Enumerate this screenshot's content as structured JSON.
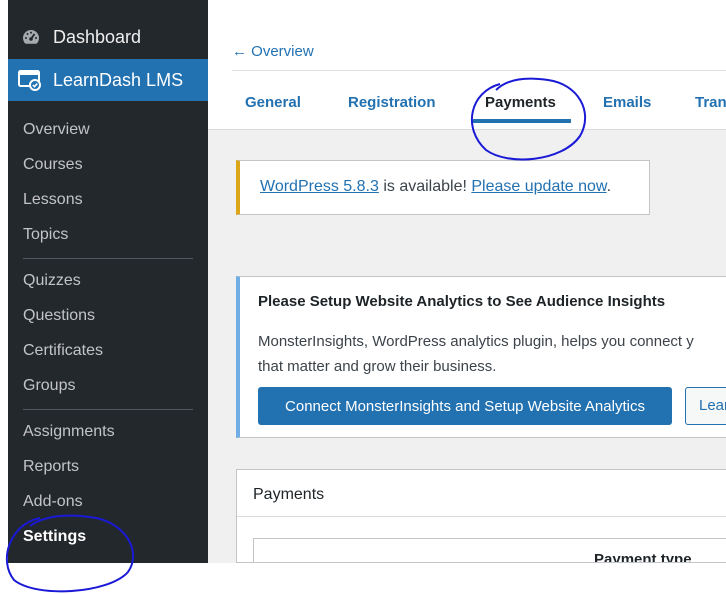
{
  "sidebar": {
    "dashboard_label": "Dashboard",
    "dashboard_icon": "dashboard-gauge-icon",
    "learndash_label": "LearnDash LMS",
    "learndash_icon": "learndash-certificate-icon",
    "items": [
      {
        "label": "Overview"
      },
      {
        "label": "Courses"
      },
      {
        "label": "Lessons"
      },
      {
        "label": "Topics"
      },
      {
        "label": "Quizzes"
      },
      {
        "label": "Questions"
      },
      {
        "label": "Certificates"
      },
      {
        "label": "Groups"
      },
      {
        "label": "Assignments"
      },
      {
        "label": "Reports"
      },
      {
        "label": "Add-ons"
      },
      {
        "label": "Settings"
      }
    ],
    "current": "Settings"
  },
  "header": {
    "back_link": "← Overview",
    "tabs": [
      {
        "label": "General"
      },
      {
        "label": "Registration"
      },
      {
        "label": "Payments"
      },
      {
        "label": "Emails"
      },
      {
        "label": "Tran"
      }
    ],
    "active_tab": "Payments"
  },
  "notice": {
    "link1": "WordPress 5.8.3",
    "middle": " is available! ",
    "link2": "Please update now",
    "end": "."
  },
  "analytics": {
    "title": "Please Setup Website Analytics to See Audience Insights",
    "body_line1": "MonsterInsights, WordPress analytics plugin, helps you connect y",
    "body_line2": "that matter and grow their business.",
    "primary_button": "Connect MonsterInsights and Setup Website Analytics",
    "secondary_button": "Lear"
  },
  "payments_panel": {
    "title": "Payments",
    "column_header": "Payment type"
  },
  "colors": {
    "sidebar_bg": "#23282d",
    "accent": "#2271b1",
    "notice_warning": "#dba617",
    "info_border": "#72aee6",
    "annotation": "#1a1ad6"
  }
}
